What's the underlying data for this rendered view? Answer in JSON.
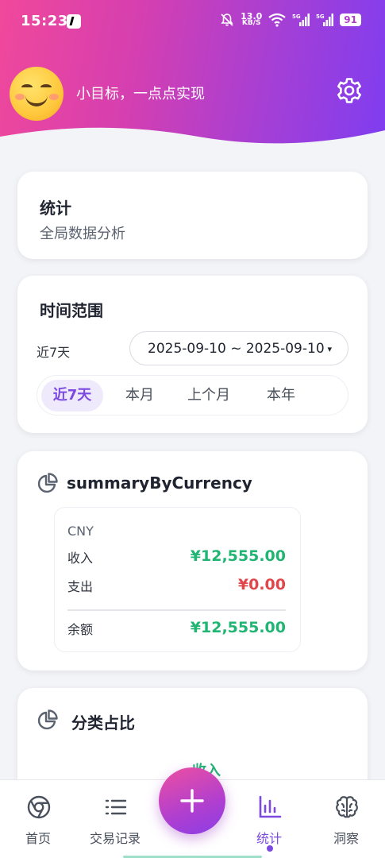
{
  "status_bar": {
    "time": "15:23",
    "net_speed_value": "13.0",
    "net_speed_unit": "KB/S",
    "signal_1": "5G",
    "signal_2": "5G",
    "battery": "91"
  },
  "header": {
    "motto": "小目标，一点点实现",
    "avatar_icon": "smiling-face-emoji",
    "settings_icon": "gear-icon",
    "gradient_start": "#f0489b",
    "gradient_end": "#7f3df0"
  },
  "stats_card": {
    "title": "统计",
    "subtitle": "全局数据分析"
  },
  "range_card": {
    "title": "时间范围",
    "current_label": "近7天",
    "date_range_value": "2025-09-10 ~ 2025-09-10",
    "caret": "▾",
    "options": [
      {
        "label": "近7天",
        "active": true
      },
      {
        "label": "本月",
        "active": false
      },
      {
        "label": "上个月",
        "active": false
      },
      {
        "label": "本年",
        "active": false
      }
    ]
  },
  "summary_card": {
    "title": "summaryByCurrency",
    "icon": "pie-chart-icon",
    "currency": "CNY",
    "income_label": "收入",
    "income_value": "¥12,555.00",
    "expense_label": "支出",
    "expense_value": "¥0.00",
    "balance_label": "余额",
    "balance_value": "¥12,555.00"
  },
  "category_card": {
    "title": "分类占比",
    "icon": "pie-chart-icon",
    "income_tab": "收入"
  },
  "bottom_nav": {
    "items": [
      {
        "label": "首页",
        "icon": "chrome-circle-icon",
        "active": false
      },
      {
        "label": "交易记录",
        "icon": "list-icon",
        "active": false
      },
      {
        "label": "统计",
        "icon": "bar-chart-icon",
        "active": true
      },
      {
        "label": "洞察",
        "icon": "brain-icon",
        "active": false
      }
    ],
    "fab_icon": "plus-icon"
  },
  "colors": {
    "accent": "#7c4ae0",
    "income": "#21b573",
    "expense": "#e1464a"
  }
}
